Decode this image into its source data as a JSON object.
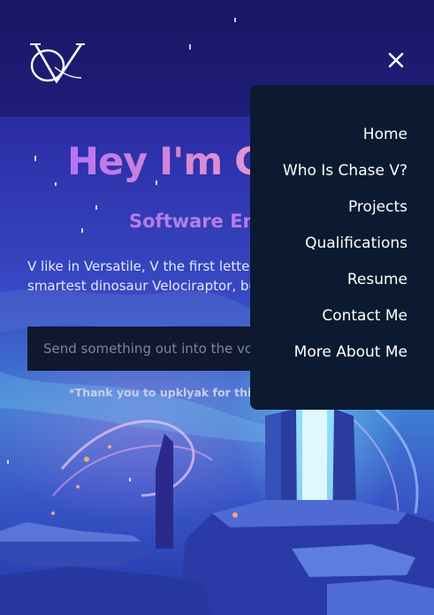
{
  "header": {
    "logo_icon": "vc-monogram-logo",
    "close_icon": "close-icon"
  },
  "hero": {
    "title": "Hey I'm Cl",
    "subtitle": "Software Eng",
    "description_line_1": "V like in Versatile, V the first letter o",
    "description_line_2": "smartest dinosaur Velociraptor, bu"
  },
  "void_input": {
    "placeholder": "Send something out into the voi",
    "value": ""
  },
  "credit": "*Thank you to upklyak for this aw",
  "nav": {
    "items": [
      {
        "label": "Home"
      },
      {
        "label": "Who Is Chase V?"
      },
      {
        "label": "Projects"
      },
      {
        "label": "Qualifications"
      },
      {
        "label": "Resume"
      },
      {
        "label": "Contact Me"
      },
      {
        "label": "More About Me"
      }
    ]
  },
  "colors": {
    "nav_background": "#0b1a30",
    "title_gradient_start": "#b873f0",
    "subtitle": "#b67de8",
    "input_background": "#10182e"
  }
}
